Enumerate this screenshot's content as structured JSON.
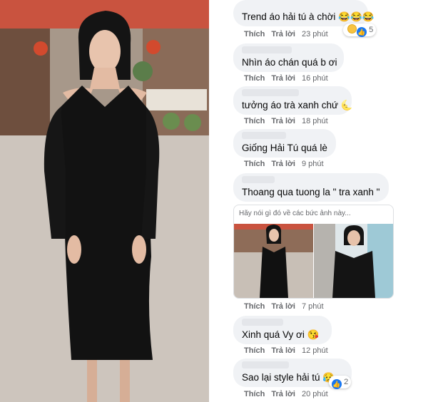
{
  "comments": [
    {
      "text": "Trend áo hải tú à chời 😂😂😂",
      "like": "Thích",
      "reply": "Trả lời",
      "time": "23 phút",
      "reaction_count": "5"
    },
    {
      "text": "Nhìn áo chán quá b ơi",
      "like": "Thích",
      "reply": "Trả lời",
      "time": "16 phút"
    },
    {
      "text": "tưởng áo trà xanh chứ 🌜",
      "like": "Thích",
      "reply": "Trả lời",
      "time": "18 phút"
    },
    {
      "text": "Giống Hải Tú quá lè",
      "like": "Thích",
      "reply": "Trả lời",
      "time": "9 phút"
    },
    {
      "text": "Thoang qua tuong la \" tra xanh \"",
      "like": "Thích",
      "reply": "Trả lời",
      "time": "7 phút"
    },
    {
      "text": "Xinh quá Vy ơi 😘",
      "like": "Thích",
      "reply": "Trả lời",
      "time": "12 phút"
    },
    {
      "text": "Sao lại style hải tú 😥",
      "like": "Thích",
      "reply": "Trả lời",
      "time": "20 phút",
      "reaction_count": "2"
    }
  ],
  "attachment": {
    "hint": "Hãy nói gì đó về các bức ảnh này..."
  },
  "colors": {
    "bubble": "#f0f2f5",
    "meta": "#65676b",
    "text": "#050505",
    "like_blue": "#1877f2"
  }
}
